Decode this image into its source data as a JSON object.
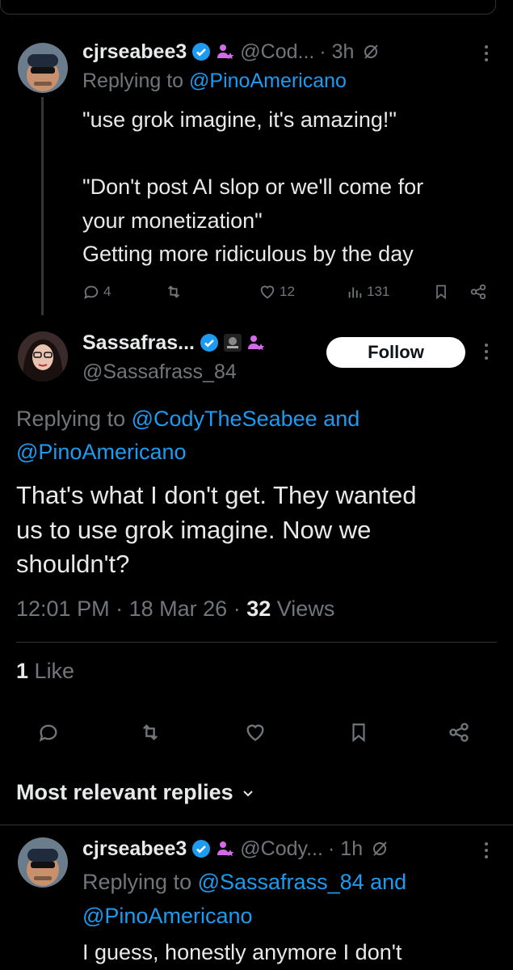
{
  "reply1": {
    "name": "cjrseabee3",
    "handle": "@Cod...",
    "time": "· 3h",
    "replying_prefix": "Replying to",
    "replying_to": "@PinoAmericano",
    "text_lines": [
      "\"use grok imagine, it's amazing!\"",
      "",
      "\"Don't post AI slop or we'll come for",
      "your monetization\"",
      "Getting more ridiculous by the day"
    ],
    "reply_count": "4",
    "like_count": "12",
    "view_count": "131"
  },
  "main": {
    "name": "Sassafras...",
    "handle": "@Sassafrass_84",
    "follow_label": "Follow",
    "replying_prefix": "Replying to",
    "replying_to_1": "@CodyTheSeabee",
    "replying_and": "and",
    "replying_to_2": "@PinoAmericano",
    "text_lines": [
      "That's what I don't get. They wanted",
      "us to use grok imagine. Now we",
      "shouldn't?"
    ],
    "time": "12:01 PM",
    "date": "18 Mar 26",
    "views_count": "32",
    "views_label": "Views",
    "likes_count": "1",
    "likes_label": "Like"
  },
  "section": {
    "heading": "Most relevant replies"
  },
  "reply2": {
    "name": "cjrseabee3",
    "handle": "@Cody...",
    "time": "· 1h",
    "replying_prefix": "Replying to",
    "replying_to_1": "@Sassafrass_84",
    "replying_and": "and",
    "replying_to_2": "@PinoAmericano",
    "text_line": "I guess, honestly anymore I don't"
  },
  "colors": {
    "accent": "#1d9bf0",
    "muted": "#71767b",
    "text": "#e7e9ea",
    "background": "#000000"
  },
  "icons": [
    "verified-icon",
    "affiliate-icon",
    "grok-icon",
    "more-icon",
    "reply-icon",
    "repost-icon",
    "like-icon",
    "views-icon",
    "bookmark-icon",
    "share-icon",
    "chevron-down-icon"
  ]
}
